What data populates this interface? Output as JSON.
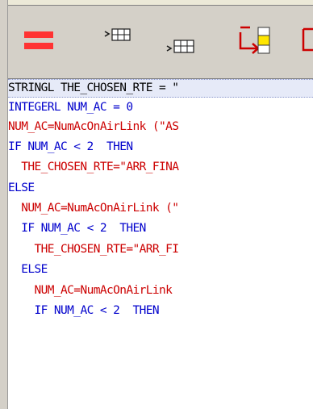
{
  "toolbar": {
    "buttons": [
      {
        "name": "delete-line-icon",
        "color": "#ff3333"
      },
      {
        "name": "insert-row-above-icon",
        "color": "#1a1a1a"
      },
      {
        "name": "insert-row-below-icon",
        "color": "#1a1a1a"
      },
      {
        "name": "move-into-block-icon",
        "color": "#cc0000",
        "accent": "#ffe600"
      },
      {
        "name": "move-out-block-icon",
        "color": "#cc0000"
      }
    ]
  },
  "editor": {
    "selected_line_bg": "#e6eaf8",
    "lines": [
      {
        "indent": "",
        "parts": [
          {
            "t": "STRINGL THE_CHOSEN_RTE = \"",
            "c": "plain"
          }
        ]
      },
      {
        "indent": "",
        "parts": [
          {
            "t": "INTEGERL NUM_AC = 0",
            "c": "kw"
          }
        ]
      },
      {
        "indent": "",
        "parts": [
          {
            "t": "NUM_AC=NumAcOnAirLink (\"AS",
            "c": "red"
          }
        ]
      },
      {
        "indent": "",
        "parts": [
          {
            "t": "IF NUM_AC < 2  THEN",
            "c": "kw"
          }
        ]
      },
      {
        "indent": "  ",
        "parts": [
          {
            "t": "THE_CHOSEN_RTE=\"ARR_FINA",
            "c": "red"
          }
        ]
      },
      {
        "indent": "",
        "parts": [
          {
            "t": "ELSE",
            "c": "kw"
          }
        ]
      },
      {
        "indent": "  ",
        "parts": [
          {
            "t": "NUM_AC=NumAcOnAirLink (\"",
            "c": "red"
          }
        ]
      },
      {
        "indent": "  ",
        "parts": [
          {
            "t": "IF NUM_AC < 2  THEN",
            "c": "kw"
          }
        ]
      },
      {
        "indent": "    ",
        "parts": [
          {
            "t": "THE_CHOSEN_RTE=\"ARR_FI",
            "c": "red"
          }
        ]
      },
      {
        "indent": "  ",
        "parts": [
          {
            "t": "ELSE",
            "c": "kw"
          }
        ]
      },
      {
        "indent": "    ",
        "parts": [
          {
            "t": "NUM_AC=NumAcOnAirLink ",
            "c": "red"
          }
        ]
      },
      {
        "indent": "    ",
        "parts": [
          {
            "t": "IF NUM_AC < 2  THEN",
            "c": "kw"
          }
        ]
      }
    ]
  }
}
